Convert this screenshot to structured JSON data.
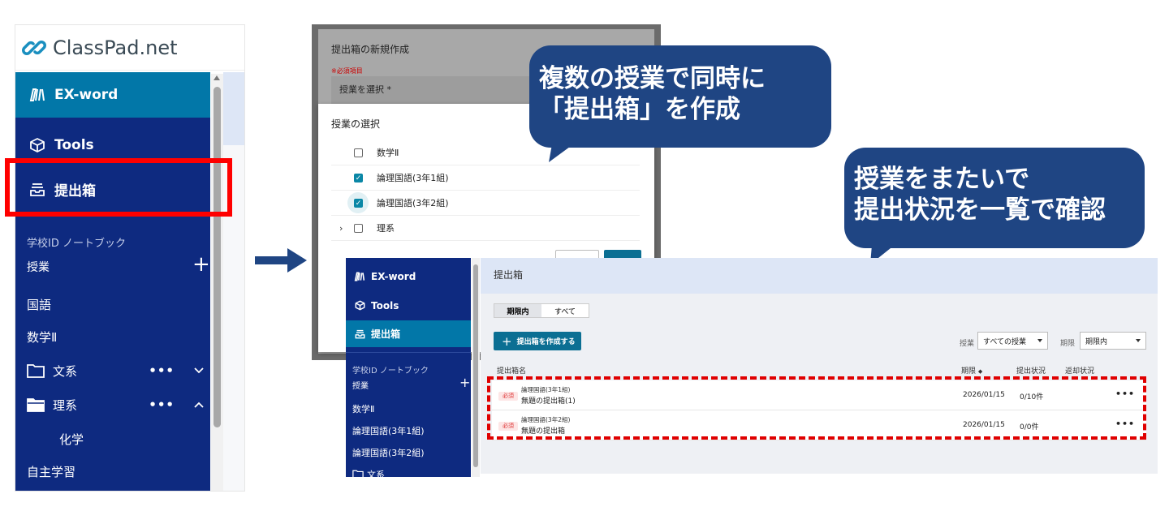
{
  "left_panel": {
    "brand": "ClassPad.net",
    "nav": {
      "exword": "EX-word",
      "tools": "Tools",
      "box": "提出箱"
    },
    "notebook": "学校ID ノートブック",
    "classes_label": "授業",
    "items": {
      "kokugo": "国語",
      "sugaku": "数学Ⅱ",
      "bunkei": "文系",
      "rikei": "理系",
      "kagaku": "化学",
      "jishu": "自主学習"
    }
  },
  "modal": {
    "back_title": "提出箱の新規作成",
    "required_note": "※必須項目",
    "select_class_field": "授業を選択 *",
    "front_title": "授業の選択",
    "options": [
      {
        "label": "数学Ⅱ",
        "checked": false
      },
      {
        "label": "論理国語(3年1組)",
        "checked": true
      },
      {
        "label": "論理国語(3年2組)",
        "checked": true
      },
      {
        "label": "理系",
        "checked": false
      }
    ]
  },
  "callouts": {
    "first_line1": "複数の授業で同時に",
    "first_line2": "「提出箱」を作成",
    "second_line1": "授業をまたいで",
    "second_line2": "提出状況を一覧で確認"
  },
  "bottom": {
    "side": {
      "exword": "EX-word",
      "tools": "Tools",
      "box": "提出箱",
      "notebook": "学校ID ノートブック",
      "classes_label": "授業",
      "items": [
        "数学Ⅱ",
        "論理国語(3年1組)",
        "論理国語(3年2組)",
        "文系"
      ]
    },
    "header": "提出箱",
    "tabs": [
      "期限内",
      "すべて"
    ],
    "create_button": "提出箱を作成する",
    "filter_class_label": "授業",
    "filter_class_value": "すべての授業",
    "filter_due_label": "期限",
    "filter_due_value": "期限内",
    "columns": {
      "name": "提出箱名",
      "due": "期限",
      "status": "提出状況",
      "return": "返却状況"
    },
    "rows": [
      {
        "badge": "必須",
        "class": "論理国語(3年1組)",
        "name": "無題の提出箱(1)",
        "due": "2026/01/15",
        "status": "0/10件"
      },
      {
        "badge": "必須",
        "class": "論理国語(3年2組)",
        "name": "無題の提出箱",
        "due": "2026/01/15",
        "status": "0/0件"
      }
    ]
  },
  "colors": {
    "nav_navy": "#0e2a80",
    "accent_teal": "#0277a8",
    "callout_blue": "#1f4583",
    "highlight_red": "#ff0000"
  }
}
